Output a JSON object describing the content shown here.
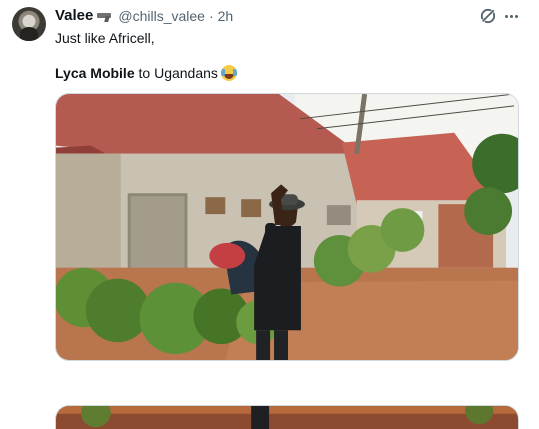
{
  "tweet": {
    "display_name": "Valee",
    "name_emoji": "pistol-emoji",
    "handle": "@chills_valee",
    "separator": "·",
    "timestamp": "2h",
    "line_one": "Just like Africell,",
    "bold_text": "Lyca Mobile",
    "rest_text": " to Ugandans",
    "trailing_emoji": "loudly-crying-face-emoji"
  },
  "icons": {
    "avatar": "profile-avatar",
    "grok": "grok-icon",
    "more": "more-options-icon"
  },
  "colors": {
    "text": "#0f1419",
    "secondary": "#536471",
    "border": "#cfd9de"
  }
}
